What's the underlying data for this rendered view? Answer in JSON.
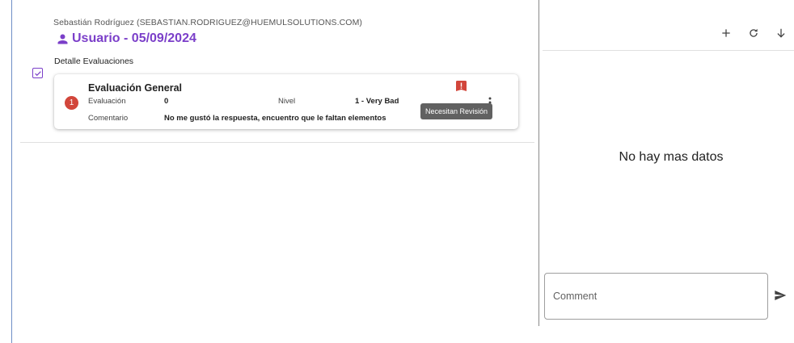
{
  "header": {
    "user_line": "Sebastián Rodríguez (SEBASTIAN.RODRIGUEZ@HUEMULSOLUTIONS.COM)",
    "title": "Usuario - 05/09/2024",
    "section_label": "Detalle Evaluaciones"
  },
  "evaluation_card": {
    "title": "Evaluación General",
    "badge_count": "1",
    "evaluacion_label": "Evaluación",
    "evaluacion_value": "0",
    "nivel_label": "Nivel",
    "nivel_value": "1 - Very Bad",
    "comentario_label": "Comentario",
    "comentario_value": "No me gustó la respuesta, encuentro que le faltan elementos",
    "tooltip": "Necesitan Revisión",
    "alert_icon": "alert-flag-icon",
    "more_icon": "more-vert-icon"
  },
  "right_panel": {
    "toolbar": [
      {
        "name": "add",
        "icon": "plus-icon"
      },
      {
        "name": "refresh",
        "icon": "refresh-icon"
      },
      {
        "name": "download",
        "icon": "arrow-down-icon"
      }
    ],
    "empty_text": "No hay mas datos",
    "comment_placeholder": "Comment",
    "send_icon": "send-icon"
  },
  "colors": {
    "accent": "#7b3fc9",
    "badge_red": "#d2463b",
    "tooltip_bg": "#616161",
    "frame_border": "#6f8fc6"
  }
}
